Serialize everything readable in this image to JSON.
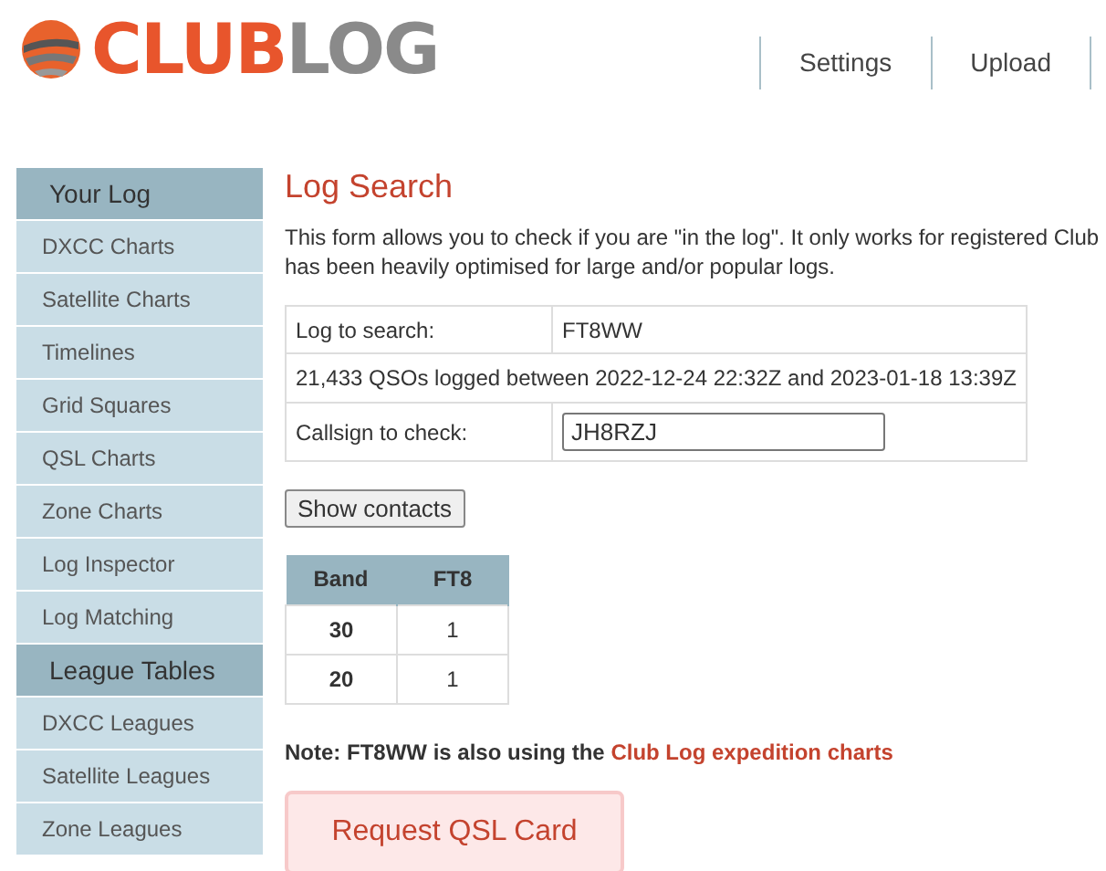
{
  "logo": {
    "part_1": "CLUB",
    "part_2": "LOG"
  },
  "nav": [
    "Settings",
    "Upload"
  ],
  "sidebar": [
    {
      "kind": "header",
      "label": "Your Log"
    },
    {
      "kind": "item",
      "label": "DXCC Charts"
    },
    {
      "kind": "item",
      "label": "Satellite Charts"
    },
    {
      "kind": "item",
      "label": "Timelines"
    },
    {
      "kind": "item",
      "label": "Grid Squares"
    },
    {
      "kind": "item",
      "label": "QSL Charts"
    },
    {
      "kind": "item",
      "label": "Zone Charts"
    },
    {
      "kind": "item",
      "label": "Log Inspector"
    },
    {
      "kind": "item",
      "label": "Log Matching"
    },
    {
      "kind": "header",
      "label": "League Tables"
    },
    {
      "kind": "item",
      "label": "DXCC Leagues"
    },
    {
      "kind": "item",
      "label": "Satellite Leagues"
    },
    {
      "kind": "item",
      "label": "Zone Leagues"
    }
  ],
  "title": "Log Search",
  "intro": "This form allows you to check if you are \"in the log\". It only works for registered Club\nhas been heavily optimised for large and/or popular logs.",
  "form": {
    "log_label": "Log to search:",
    "log_value": "FT8WW",
    "summary": "21,433 QSOs logged between 2022-12-24 22:32Z and 2023-01-18 13:39Z",
    "callsign_label": "Callsign to check:",
    "callsign_value": "JH8RZJ"
  },
  "show_button": "Show contacts",
  "results": {
    "columns": [
      "Band",
      "FT8"
    ],
    "rows": [
      [
        "30",
        "1"
      ],
      [
        "20",
        "1"
      ]
    ]
  },
  "note": {
    "text": "Note: FT8WW is also using the",
    "link": "Club Log expedition charts"
  },
  "qsl_button": "Request QSL Card"
}
